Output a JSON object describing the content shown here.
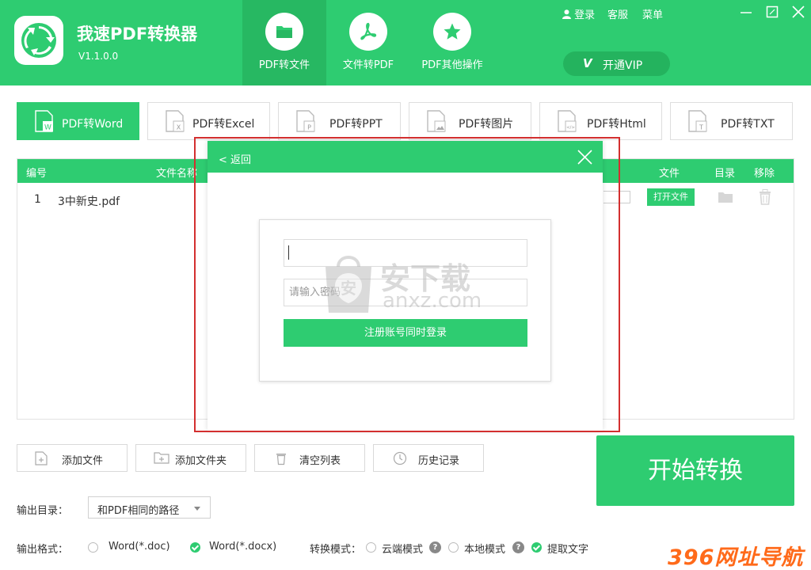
{
  "app": {
    "title": "我速PDF转换器",
    "version": "V1.1.0.0"
  },
  "nav_tabs": [
    {
      "label": "PDF转文件",
      "icon": "folder-icon",
      "active": true
    },
    {
      "label": "文件转PDF",
      "icon": "pdf-icon",
      "active": false
    },
    {
      "label": "PDF其他操作",
      "icon": "star-icon",
      "active": false
    }
  ],
  "top_links": {
    "login": "登录",
    "support": "客服",
    "menu": "菜单"
  },
  "vip": {
    "badge": "V",
    "label": "开通VIP"
  },
  "conv_tabs": [
    {
      "label": "PDF转Word",
      "letter": "W",
      "active": true
    },
    {
      "label": "PDF转Excel",
      "letter": "X",
      "active": false
    },
    {
      "label": "PDF转PPT",
      "letter": "P",
      "active": false
    },
    {
      "label": "PDF转图片",
      "letter": "",
      "active": false
    },
    {
      "label": "PDF转Html",
      "letter": "</>",
      "active": false
    },
    {
      "label": "PDF转TXT",
      "letter": "T",
      "active": false
    }
  ],
  "table": {
    "columns": {
      "index": "编号",
      "filename": "文件名称",
      "file": "文件",
      "dir": "目录",
      "remove": "移除"
    },
    "rows": [
      {
        "index": "1",
        "name": "3中新史.pdf",
        "open_label": "打开文件"
      }
    ]
  },
  "actions": {
    "add_file": "添加文件",
    "add_folder": "添加文件夹",
    "clear": "清空列表",
    "history": "历史记录"
  },
  "start_button": "开始转换",
  "output": {
    "dir_label": "输出目录：",
    "dir_value": "和PDF相同的路径",
    "format_label": "输出格式：",
    "formats": [
      {
        "label": "Word(*.doc)",
        "checked": false
      },
      {
        "label": "Word(*.docx)",
        "checked": true
      }
    ],
    "mode_label": "转换模式：",
    "modes": {
      "cloud": "云端模式",
      "local": "本地模式",
      "extract": "提取文字"
    },
    "help": "?"
  },
  "dialog": {
    "back": "< 返回",
    "username_value": "",
    "password_placeholder": "请输入密码",
    "submit": "注册账号同时登录"
  },
  "watermarks": {
    "anxz_cn": "安下载",
    "anxz_en": "anxz.com",
    "bag_char": "安",
    "site396": "396网址导航"
  },
  "colors": {
    "primary": "#2ecc71",
    "primary_dark": "#27b862",
    "highlight_border": "#d32f2f",
    "watermark_orange": "#ff6a1a"
  }
}
